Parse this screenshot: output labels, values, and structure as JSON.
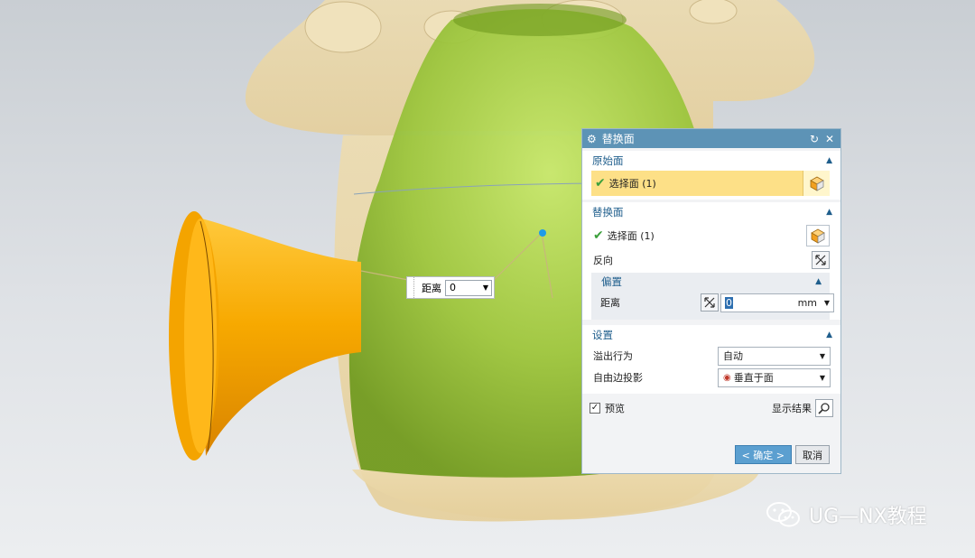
{
  "dialog": {
    "title": "替换面",
    "section_original": {
      "header": "原始面",
      "select_label": "选择面 (1)"
    },
    "section_replace": {
      "header": "替换面",
      "select_label": "选择面 (1)",
      "reverse_label": "反向",
      "offset": {
        "header": "偏置",
        "distance_label": "距离",
        "distance_value": "0",
        "unit": "mm"
      }
    },
    "section_settings": {
      "header": "设置",
      "overflow_label": "溢出行为",
      "overflow_value": "自动",
      "projection_label": "自由边投影",
      "projection_value": "垂直于面"
    },
    "preview_label": "预览",
    "show_result_label": "显示结果",
    "ok_label": "< 确定 >",
    "cancel_label": "取消"
  },
  "floating_input": {
    "label": "距离",
    "value": "0"
  },
  "watermark": "UG—NX教程",
  "colors": {
    "titlebar": "#5d93b6",
    "section_header": "#1f5e8c",
    "selected_row": "#fde087",
    "model_green": "#9cc63c",
    "model_orange": "#f5a800",
    "model_beige": "#ead7a9"
  }
}
